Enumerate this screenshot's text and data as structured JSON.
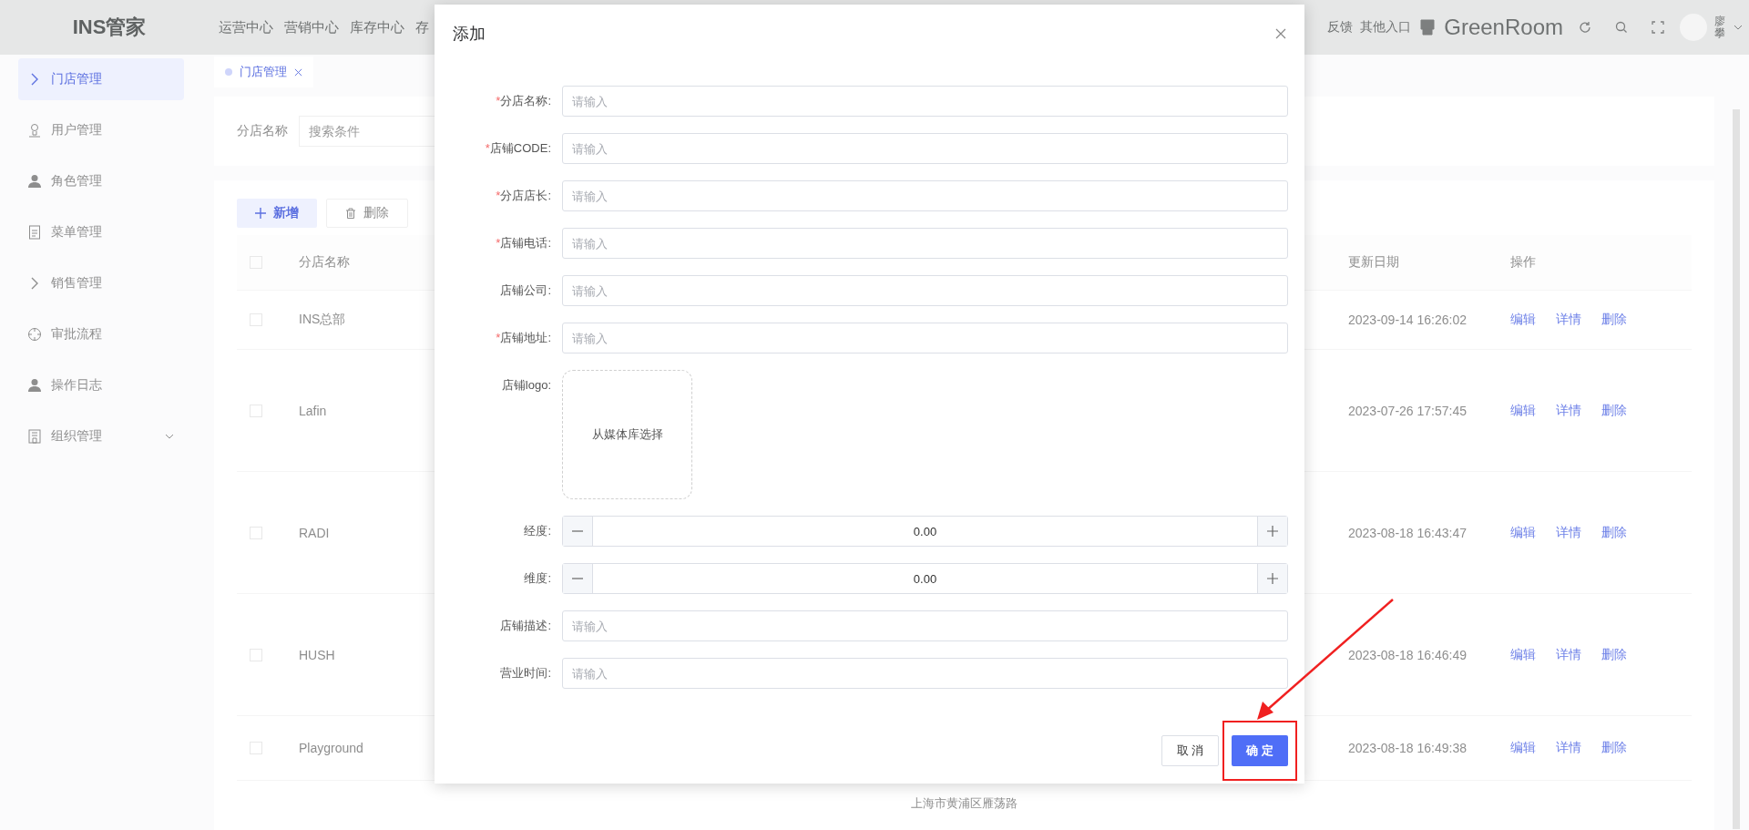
{
  "header": {
    "logo": "INS管家",
    "nav": [
      "运营中心",
      "营销中心",
      "库存中心",
      "存"
    ],
    "links": [
      "反馈",
      "其他入口"
    ],
    "store_name": "GreenRoom",
    "user_name": "廖攀"
  },
  "sidebar": {
    "items": [
      {
        "label": "门店管理",
        "selected": true,
        "expandable": false
      },
      {
        "label": "用户管理",
        "selected": false,
        "expandable": false
      },
      {
        "label": "角色管理",
        "selected": false,
        "expandable": false
      },
      {
        "label": "菜单管理",
        "selected": false,
        "expandable": false
      },
      {
        "label": "销售管理",
        "selected": false,
        "expandable": false
      },
      {
        "label": "审批流程",
        "selected": false,
        "expandable": false
      },
      {
        "label": "操作日志",
        "selected": false,
        "expandable": false
      },
      {
        "label": "组织管理",
        "selected": false,
        "expandable": true
      }
    ]
  },
  "tabs": [
    {
      "label": "门店管理",
      "selected": true
    }
  ],
  "search": {
    "label": "分店名称",
    "placeholder": "搜索条件"
  },
  "toolbar": [
    {
      "label": "新增",
      "kind": "primary"
    },
    {
      "label": "删除",
      "kind": "default"
    }
  ],
  "table": {
    "columns": [
      "分店名称",
      "更新日期",
      "操作"
    ],
    "header_checked": false,
    "rows": [
      {
        "name": "INS总部",
        "updated": "2023-09-14 16:26:02",
        "checked": false,
        "actions": [
          "编辑",
          "详情",
          "删除"
        ]
      },
      {
        "name": "Lafin",
        "updated": "2023-07-26 17:57:45",
        "checked": false,
        "actions": [
          "编辑",
          "详情",
          "删除"
        ]
      },
      {
        "name": "RADI",
        "updated": "2023-08-18 16:43:47",
        "checked": false,
        "actions": [
          "编辑",
          "详情",
          "删除"
        ]
      },
      {
        "name": "HUSH",
        "updated": "2023-08-18 16:46:49",
        "checked": false,
        "actions": [
          "编辑",
          "详情",
          "删除"
        ]
      },
      {
        "name": "Playground",
        "updated": "2023-08-18 16:49:38",
        "checked": false,
        "actions": [
          "编辑",
          "详情",
          "删除"
        ]
      }
    ]
  },
  "footer_text": "上海市黄浦区雁荡路",
  "dialog": {
    "title": "添加",
    "required_mark": "*",
    "fields": [
      {
        "kind": "text",
        "label": "分店名称:",
        "required": true,
        "placeholder": "请输入"
      },
      {
        "kind": "text",
        "label": "店铺CODE:",
        "required": true,
        "placeholder": "请输入"
      },
      {
        "kind": "text",
        "label": "分店店长:",
        "required": true,
        "placeholder": "请输入"
      },
      {
        "kind": "text",
        "label": "店铺电话:",
        "required": true,
        "placeholder": "请输入"
      },
      {
        "kind": "text",
        "label": "店铺公司:",
        "required": false,
        "placeholder": "请输入"
      },
      {
        "kind": "text",
        "label": "店铺地址:",
        "required": true,
        "placeholder": "请输入"
      },
      {
        "kind": "upload",
        "label": "店铺logo:",
        "required": false,
        "button_text": "从媒体库选择"
      },
      {
        "kind": "number",
        "label": "经度:",
        "required": false,
        "value": "0.00"
      },
      {
        "kind": "number",
        "label": "维度:",
        "required": false,
        "value": "0.00"
      },
      {
        "kind": "text",
        "label": "店铺描述:",
        "required": false,
        "placeholder": "请输入"
      },
      {
        "kind": "text",
        "label": "营业时间:",
        "required": false,
        "placeholder": "请输入"
      }
    ],
    "buttons": [
      {
        "label": "取 消",
        "kind": "default",
        "highlighted": false
      },
      {
        "label": "确 定",
        "kind": "primary",
        "highlighted": true
      }
    ]
  }
}
